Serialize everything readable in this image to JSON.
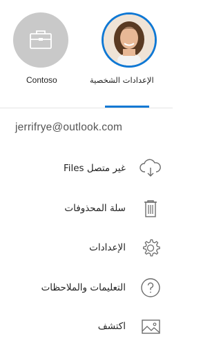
{
  "accounts": [
    {
      "name": "Contoso",
      "icon": "briefcase-icon"
    },
    {
      "name": "الإعدادات الشخصية",
      "icon": "user-photo"
    }
  ],
  "email": "jerrifrye@outlook.com",
  "menu": [
    {
      "label": "غير متصل Files",
      "icon": "cloud-download-icon"
    },
    {
      "label": "سلة المحذوفات",
      "icon": "trash-icon"
    },
    {
      "label": "الإعدادات",
      "icon": "gear-icon"
    },
    {
      "label": "التعليمات والملاحظات",
      "icon": "help-icon"
    },
    {
      "label": "اكتشف",
      "icon": "image-icon"
    }
  ],
  "colors": {
    "accent": "#0f78d4",
    "avatar_gray": "#c9c9c9",
    "icon_gray": "#6b6b6b"
  }
}
